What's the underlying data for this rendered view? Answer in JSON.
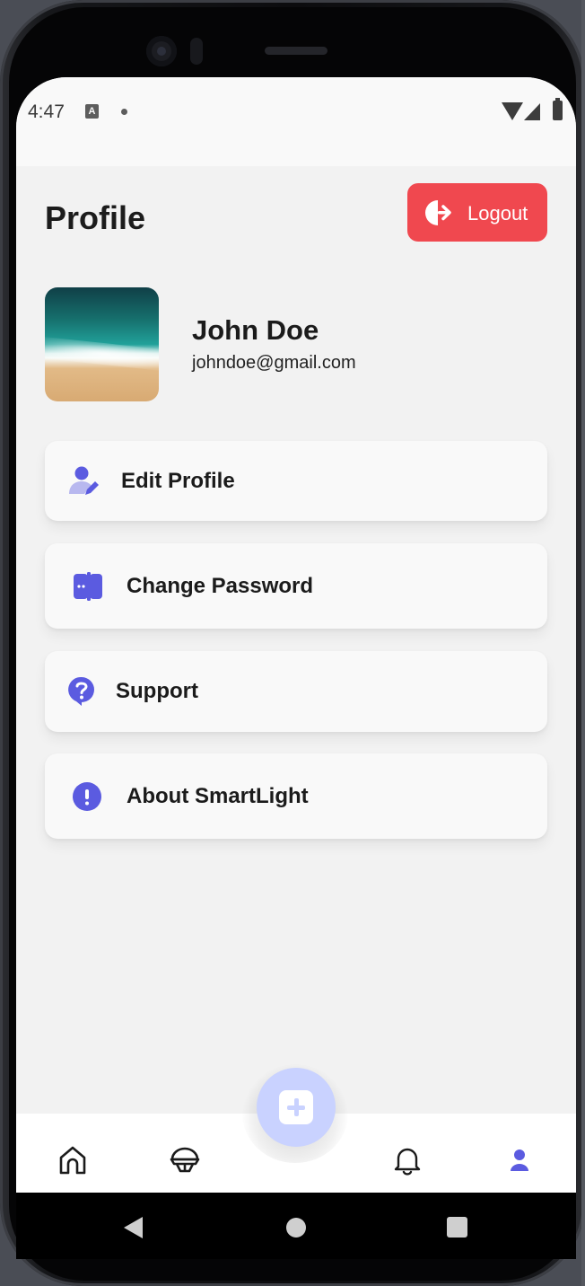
{
  "status_bar": {
    "time": "4:47",
    "notification_icon": "a-letter-icon"
  },
  "header": {
    "title": "Profile",
    "logout_label": "Logout"
  },
  "user": {
    "name": "John Doe",
    "email": "johndoe@gmail.com"
  },
  "menu": [
    {
      "label": "Edit Profile",
      "icon": "user-edit-icon"
    },
    {
      "label": "Change Password",
      "icon": "password-lock-icon"
    },
    {
      "label": "Support",
      "icon": "question-bubble-icon"
    },
    {
      "label": "About SmartLight",
      "icon": "info-exclamation-icon"
    }
  ],
  "tabs": [
    {
      "icon": "home-icon"
    },
    {
      "icon": "lamp-icon"
    },
    {
      "icon": "add-icon"
    },
    {
      "icon": "bell-icon"
    },
    {
      "icon": "profile-icon",
      "active": true
    }
  ],
  "colors": {
    "accent": "#5b5be0",
    "logout": "#f0484f",
    "fab": "#c9d2ff",
    "background": "#f2f2f2",
    "card": "#f9f9f9"
  }
}
